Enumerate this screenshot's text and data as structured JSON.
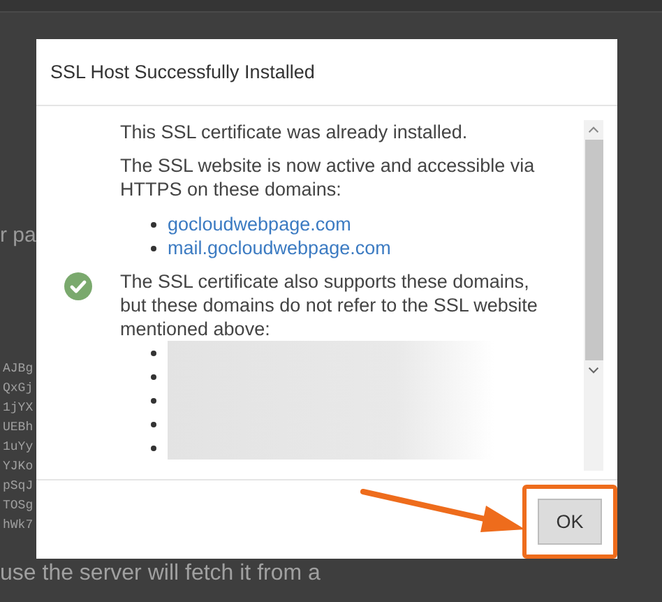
{
  "background": {
    "fragment": "r pa",
    "code_lines": [
      "AJBg",
      "QxGj",
      "1jYX",
      "UEBh",
      "1uYy",
      "YJKo",
      "pSqJ",
      "TOSg",
      "hWk7"
    ],
    "sentence": "use the server will fetch it from a"
  },
  "dialog": {
    "title": "SSL Host Successfully Installed",
    "messages": [
      {
        "kind": "plain",
        "text": "This SSL certificate was already installed."
      },
      {
        "kind": "plain",
        "text": "The SSL website is now active and accessible via HTTPS on these domains:",
        "domains": [
          "gocloudwebpage.com",
          "mail.gocloudwebpage.com"
        ]
      },
      {
        "kind": "success",
        "text": "The SSL certificate also supports these domains, but these domains do not refer to the SSL website mentioned above:",
        "redacted_domains": [
          {
            "redacted": true
          },
          {
            "redacted": true
          },
          {
            "redacted": true
          },
          {
            "redacted": true
          },
          {
            "redacted": true
          }
        ]
      }
    ],
    "buttons": [
      {
        "label": "OK",
        "highlighted": true
      }
    ]
  }
}
